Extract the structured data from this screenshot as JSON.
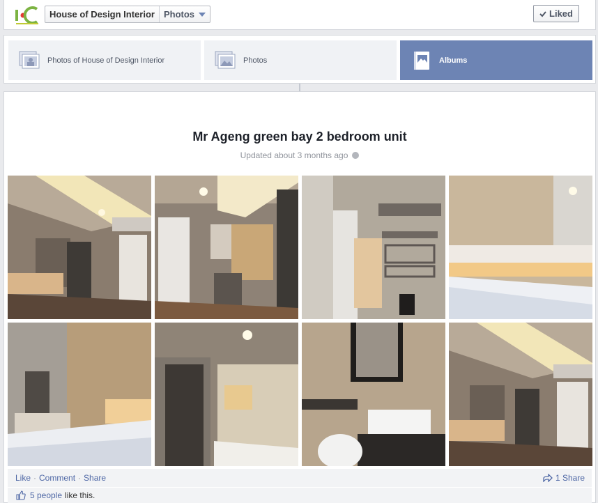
{
  "header": {
    "logo_text": "HC",
    "page_name": "House of Design Interior",
    "section": "Photos",
    "liked_label": "Liked"
  },
  "tabs": [
    {
      "label": "Photos of House of Design Interior",
      "active": false
    },
    {
      "label": "Photos",
      "active": false
    },
    {
      "label": "Albums",
      "active": true
    }
  ],
  "album": {
    "title": "Mr Ageng green bay 2 bedroom unit",
    "updated": "Updated about 3 months ago"
  },
  "actions": {
    "like": "Like",
    "comment": "Comment",
    "share": "Share",
    "share_count": "1 Share"
  },
  "likes": {
    "count_link": "5 people",
    "suffix": "like this."
  },
  "colors": {
    "accent": "#6d84b4",
    "link": "#4e67a5"
  }
}
